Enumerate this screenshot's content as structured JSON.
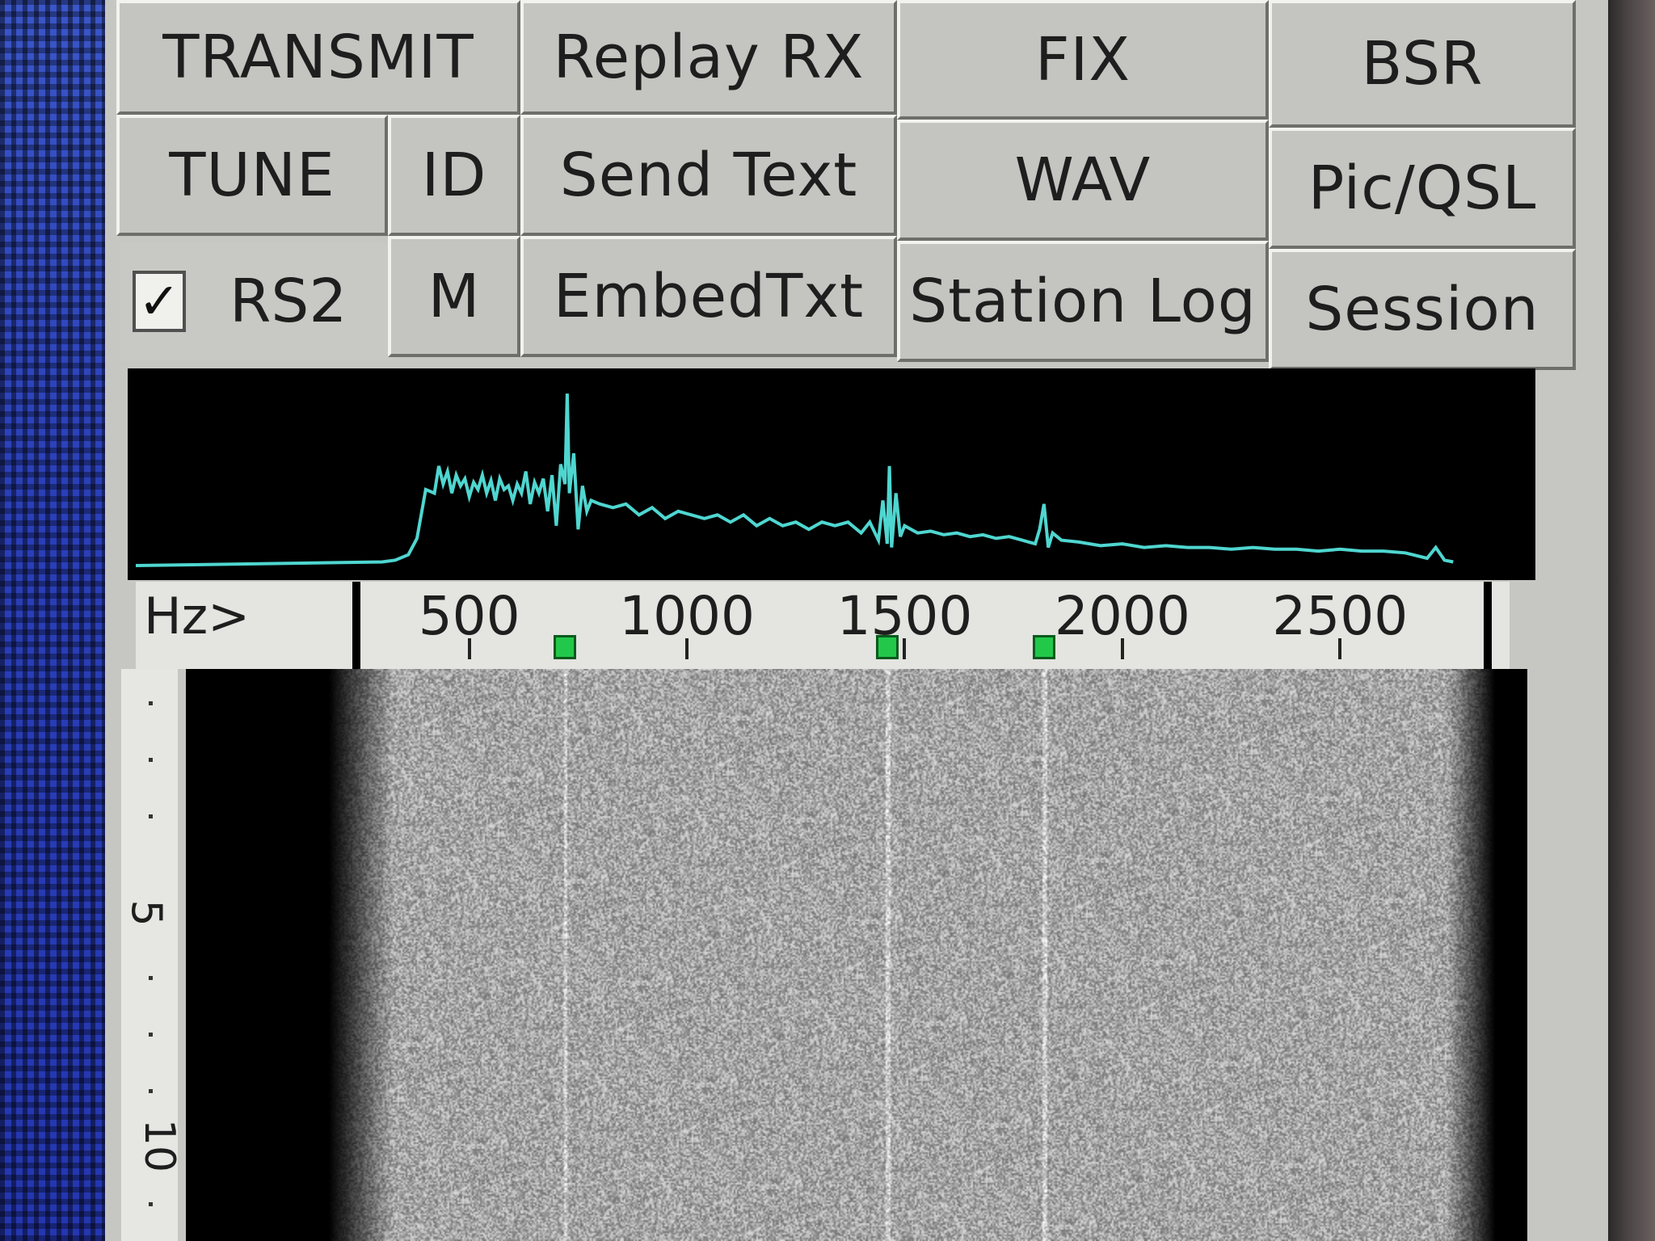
{
  "buttons": {
    "transmit": "TRANSMIT",
    "replay_rx": "Replay RX",
    "fix": "FIX",
    "bsr": "BSR",
    "tune": "TUNE",
    "id": "ID",
    "send_text": "Send Text",
    "wav": "WAV",
    "pic_qsl": "Pic/QSL",
    "rs2": "RS2",
    "m": "M",
    "embed_txt": "EmbedTxt",
    "station_log": "Station Log",
    "session": "Session"
  },
  "rs2_checked": true,
  "checkmark": "✓",
  "scale": {
    "unit_label": "Hz>",
    "ticks": [
      "500",
      "1000",
      "1500",
      "2000",
      "2500"
    ],
    "tick_values": [
      500,
      1000,
      1500,
      2000,
      2500
    ],
    "marker_values": [
      720,
      1460,
      1820
    ]
  },
  "time_axis": {
    "labels": [
      "5",
      "10"
    ]
  },
  "colors": {
    "spectrum_trace": "#4fd6d0",
    "marker": "#22c84a",
    "window_face": "#c6c6c2"
  },
  "chart_data": {
    "type": "line",
    "x": [
      300,
      330,
      360,
      380,
      400,
      420,
      430,
      440,
      450,
      460,
      470,
      480,
      490,
      500,
      510,
      520,
      530,
      540,
      550,
      560,
      570,
      580,
      590,
      600,
      610,
      620,
      630,
      640,
      650,
      660,
      670,
      680,
      690,
      700,
      710,
      720,
      725,
      730,
      740,
      750,
      760,
      770,
      780,
      800,
      830,
      860,
      890,
      920,
      950,
      980,
      1010,
      1040,
      1070,
      1100,
      1130,
      1160,
      1190,
      1220,
      1250,
      1280,
      1310,
      1340,
      1370,
      1400,
      1420,
      1440,
      1450,
      1460,
      1465,
      1470,
      1480,
      1490,
      1500,
      1530,
      1560,
      1590,
      1620,
      1650,
      1680,
      1710,
      1740,
      1770,
      1800,
      1810,
      1820,
      1830,
      1840,
      1860,
      1900,
      1950,
      2000,
      2050,
      2100,
      2150,
      2200,
      2250,
      2300,
      2350,
      2400,
      2450,
      2500,
      2550,
      2600,
      2650,
      2700,
      2720,
      2740,
      2760,
      2800
    ],
    "y": [
      0.02,
      0.03,
      0.06,
      0.15,
      0.42,
      0.4,
      0.55,
      0.45,
      0.52,
      0.4,
      0.5,
      0.44,
      0.48,
      0.38,
      0.46,
      0.42,
      0.5,
      0.4,
      0.47,
      0.36,
      0.48,
      0.42,
      0.44,
      0.36,
      0.45,
      0.4,
      0.52,
      0.34,
      0.46,
      0.4,
      0.48,
      0.3,
      0.5,
      0.22,
      0.56,
      0.45,
      0.95,
      0.4,
      0.62,
      0.2,
      0.44,
      0.3,
      0.36,
      0.34,
      0.32,
      0.34,
      0.28,
      0.32,
      0.26,
      0.3,
      0.28,
      0.26,
      0.28,
      0.24,
      0.28,
      0.22,
      0.26,
      0.22,
      0.24,
      0.2,
      0.24,
      0.22,
      0.24,
      0.18,
      0.24,
      0.14,
      0.36,
      0.12,
      0.55,
      0.1,
      0.4,
      0.16,
      0.22,
      0.18,
      0.19,
      0.17,
      0.18,
      0.16,
      0.17,
      0.15,
      0.16,
      0.14,
      0.12,
      0.2,
      0.34,
      0.1,
      0.18,
      0.14,
      0.13,
      0.11,
      0.12,
      0.1,
      0.11,
      0.1,
      0.1,
      0.09,
      0.1,
      0.09,
      0.09,
      0.08,
      0.09,
      0.08,
      0.08,
      0.07,
      0.04,
      0.1,
      0.03,
      0.02
    ],
    "xlim": [
      250,
      2830
    ],
    "ylim": [
      0,
      1
    ],
    "grid": false
  }
}
